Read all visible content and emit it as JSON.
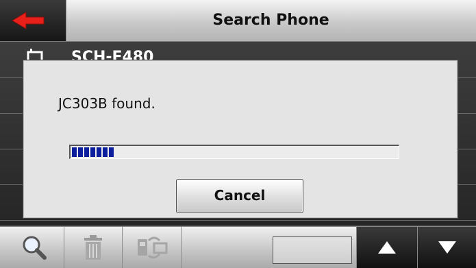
{
  "header": {
    "title": "Search Phone",
    "back_icon": "back-arrow-icon",
    "back_color": "#e8201a"
  },
  "list": {
    "items": [
      {
        "label": "SCH-F480",
        "icon": "phone-icon"
      }
    ]
  },
  "dialog": {
    "message": "JC303B found.",
    "progress_fraction": 0.14,
    "progress_color": "#0b1e9c",
    "cancel_label": "Cancel"
  },
  "toolbar": {
    "buttons": [
      {
        "icon": "search-icon"
      },
      {
        "icon": "trash-icon"
      },
      {
        "icon": "phone-sync-icon"
      },
      {
        "icon": "up-arrow-icon"
      },
      {
        "icon": "down-arrow-icon"
      }
    ]
  }
}
